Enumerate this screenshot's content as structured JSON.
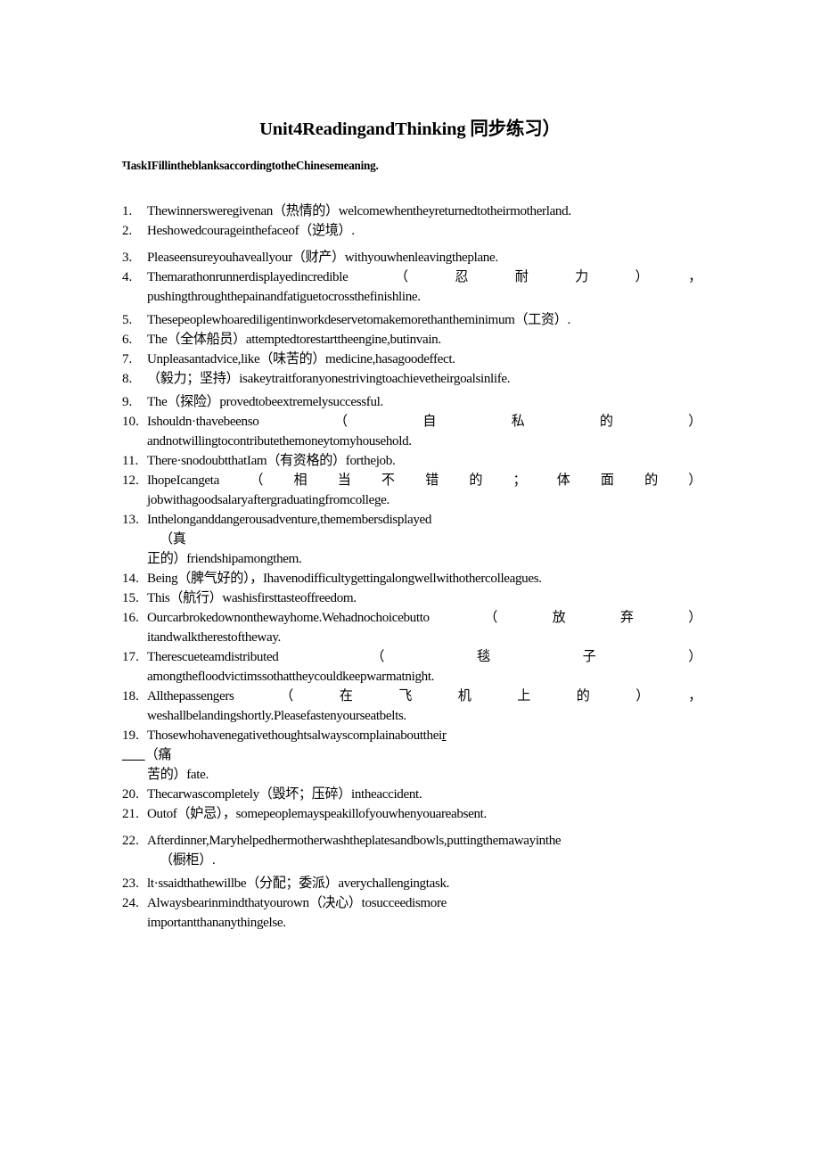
{
  "document": {
    "title": "Unit4ReadingandThinking 同步练习）",
    "task_heading": "ᵀIaskIFillintheblanksaccordingtotheChinesemeaning."
  },
  "exercises": [
    {
      "number": "1.",
      "lines": [
        {
          "type": "normal",
          "text": "Thewinnersweregivenan（热情的）welcomewhentheyreturnedtotheirmotherland."
        }
      ]
    },
    {
      "number": "2.",
      "lines": [
        {
          "type": "normal",
          "text": "Heshowedcourageinthefaceof（逆境）."
        }
      ]
    },
    {
      "number": "3.",
      "lines": [
        {
          "type": "normal",
          "text": "Pleaseensureyouhaveallyour（财产）withyouwhenleavingtheplane."
        }
      ]
    },
    {
      "number": "4.",
      "lines": [
        {
          "type": "justify",
          "text": "Themarathonrunnerdisplayedincredible（忍耐力），"
        },
        {
          "type": "normal",
          "text": "pushingthroughthepainandfatiguetocrossthefinishline."
        }
      ]
    },
    {
      "number": "5.",
      "lines": [
        {
          "type": "normal",
          "text": "Thesepeoplewhoarediligentinworkdeservetomakemorethantheminimum（工资）."
        }
      ]
    },
    {
      "number": "6.",
      "lines": [
        {
          "type": "normal",
          "text": "The（全体船员）attemptedtorestarttheengine,butinvain."
        }
      ]
    },
    {
      "number": "7.",
      "lines": [
        {
          "type": "normal",
          "text": "Unpleasantadvice,like（味苦的）medicine,hasagoodeffect."
        }
      ]
    },
    {
      "number": "8.",
      "lines": [
        {
          "type": "normal",
          "text": "（毅力；坚持）isakeytraitforanyonestrivingtoachievetheirgoalsinlife."
        }
      ]
    },
    {
      "number": "9.",
      "lines": [
        {
          "type": "normal",
          "text": "The（探险）provedtobeextremelysuccessful."
        }
      ]
    },
    {
      "number": "10.",
      "lines": [
        {
          "type": "justify",
          "text": "Ishouldn·thavebeenso（自私的）"
        },
        {
          "type": "normal",
          "text": "andnotwillingtocontributethemoneytomyhousehold."
        }
      ]
    },
    {
      "number": "11.",
      "lines": [
        {
          "type": "normal",
          "text": "There·snodoubtthatIam（有资格的）forthejob."
        }
      ]
    },
    {
      "number": "12.",
      "lines": [
        {
          "type": "justify",
          "text": "IhopeIcangeta（相当不错的；体面的）"
        },
        {
          "type": "normal",
          "text": "jobwithagoodsalaryaftergraduatingfromcollege."
        }
      ]
    },
    {
      "number": "13.",
      "lines": [
        {
          "type": "normal",
          "text": "Inthelonganddangerousadventure,themembersdisplayed"
        },
        {
          "type": "indent",
          "text": "（真"
        },
        {
          "type": "normal",
          "text": "正的）friendshipamongthem."
        }
      ]
    },
    {
      "number": "14.",
      "lines": [
        {
          "type": "normal",
          "text": "Being（脾气好的），Ihavenodifficultygettingalongwellwithothercolleagues."
        }
      ]
    },
    {
      "number": "15.",
      "lines": [
        {
          "type": "normal",
          "text": "This（航行）washisfirsttasteoffreedom."
        }
      ]
    },
    {
      "number": "16.",
      "lines": [
        {
          "type": "justify",
          "text": "Ourcarbrokedownonthewayhome.Wehadnochoicebutto（放弃）"
        },
        {
          "type": "normal",
          "text": "itandwalktherestoftheway."
        }
      ]
    },
    {
      "number": "17.",
      "lines": [
        {
          "type": "justify",
          "text": "Therescueteamdistributed（毯子）"
        },
        {
          "type": "normal",
          "text": "amongthefloodvictimssothattheycouldkeepwarmatnight."
        }
      ]
    },
    {
      "number": "18.",
      "lines": [
        {
          "type": "justify",
          "text": "Allthepassengers（在飞机上的），"
        },
        {
          "type": "normal",
          "text": "weshallbelandingshortly.Pleasefastenyourseatbelts."
        }
      ]
    },
    {
      "number": "19.",
      "lines": [
        {
          "type": "underline-tail",
          "text": "Thosewhohavenegativethoughtsalwayscomplainabouttheir",
          "tail": "r"
        },
        {
          "type": "blank-outdent",
          "blank": "___",
          "text": "（痛"
        },
        {
          "type": "normal",
          "text": "苦的）fate."
        }
      ]
    },
    {
      "number": "20.",
      "lines": [
        {
          "type": "normal",
          "text": "Thecarwascompletely（毁坏；压碎）intheaccident."
        }
      ]
    },
    {
      "number": "21.",
      "lines": [
        {
          "type": "normal",
          "text": "Outof（妒忌），somepeoplemayspeakillofyouwhenyouareabsent."
        }
      ]
    },
    {
      "number": "22.",
      "lines": [
        {
          "type": "normal",
          "text": "Afterdinner,Maryhelpedhermotherwashtheplatesandbowls,puttingthemawayinthe"
        },
        {
          "type": "indent",
          "text": "（橱柜）."
        }
      ]
    },
    {
      "number": "23.",
      "lines": [
        {
          "type": "normal",
          "text": "lt·ssaidthathewillbe（分配；委派）averychallengingtask."
        }
      ]
    },
    {
      "number": "24.",
      "lines": [
        {
          "type": "normal",
          "text": "Alwaysbearinmindthatyourown（决心）tosucceedismore"
        },
        {
          "type": "normal",
          "text": "importantthananythingelse."
        }
      ]
    }
  ]
}
